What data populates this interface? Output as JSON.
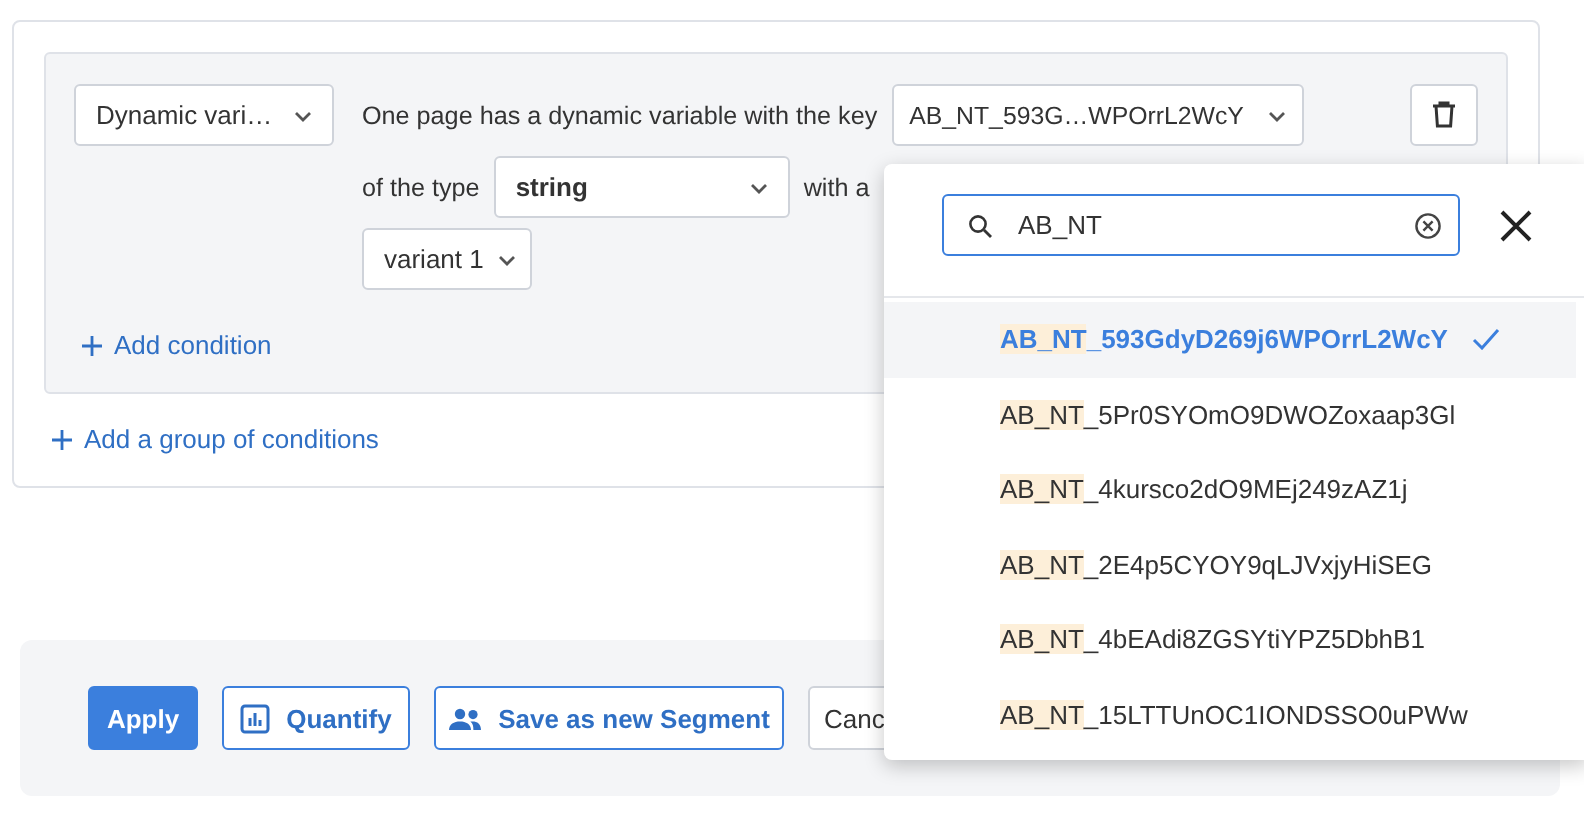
{
  "condition_group": {
    "condition_type": {
      "value": "Dynamic vari…"
    },
    "sentence_1": "One page has a dynamic variable with the key",
    "key_select": {
      "value": "AB_NT_593G…WPOrrL2WcY"
    },
    "sentence_2": "of the type",
    "type_select": {
      "value": "string"
    },
    "sentence_3": "with a",
    "value_select": {
      "value": "variant 1"
    },
    "add_condition": "Add condition"
  },
  "add_group": "Add a group of conditions",
  "actions": [
    {
      "label": "Apply",
      "kind": "primary"
    },
    {
      "label": "Quantify",
      "kind": "chart"
    },
    {
      "label": "Save as new Segment",
      "kind": "people"
    },
    {
      "label": "Canc",
      "kind": "plain"
    }
  ],
  "key_popup": {
    "search": {
      "value": "AB_NT"
    },
    "options": [
      {
        "match": "AB_NT",
        "rest": "_593GdyD269j6WPOrrL2WcY",
        "selected": true
      },
      {
        "match": "AB_NT",
        "rest": "_5Pr0SYOmO9DWOZoxaap3Gl",
        "selected": false
      },
      {
        "match": "AB_NT",
        "rest": "_4kursco2dO9MEj249zAZ1j",
        "selected": false
      },
      {
        "match": "AB_NT",
        "rest": "_2E4p5CYOY9qLJVxjyHiSEG",
        "selected": false
      },
      {
        "match": "AB_NT",
        "rest": "_4bEAdi8ZGSYtiYPZ5DbhB1",
        "selected": false
      },
      {
        "match": "AB_NT",
        "rest": "_15LTTUnOC1IONDSSO0uPWw",
        "selected": false
      }
    ]
  }
}
